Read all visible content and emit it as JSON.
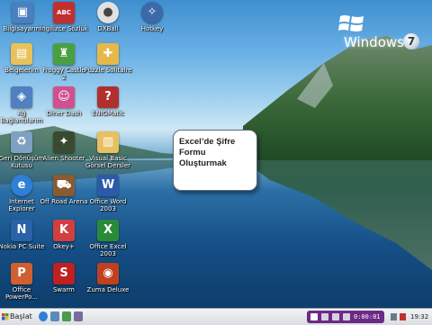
{
  "desktop_icons": [
    {
      "label": "Bilgisayarım",
      "icon": "computer-icon",
      "color": "#4a7fc0"
    },
    {
      "label": "İngilizce Sözlük",
      "icon": "dictionary-icon",
      "color": "#c03030"
    },
    {
      "label": "DXBall",
      "icon": "dxball-icon",
      "color": "#e0e0e0"
    },
    {
      "label": "Hotkey",
      "icon": "hotkey-icon",
      "color": "#3a6aa8"
    },
    {
      "label": "Belgelerim",
      "icon": "documents-folder-icon",
      "color": "#e8c25a"
    },
    {
      "label": "Froggy Castle 2",
      "icon": "frog-game-icon",
      "color": "#4aa040"
    },
    {
      "label": "Puzzle Solitaire",
      "icon": "puzzle-game-icon",
      "color": "#e6b84a"
    },
    {
      "label": "Ağ Bağlantılarım",
      "icon": "network-icon",
      "color": "#5080c0"
    },
    {
      "label": "Diner Dash",
      "icon": "diner-dash-icon",
      "color": "#d05090"
    },
    {
      "label": "ENIGMatic",
      "icon": "enigmatic-icon",
      "color": "#b03030"
    },
    {
      "label": "Geri Dönüşüm Kutusu",
      "icon": "recycle-bin-icon",
      "color": "#7fa0c0"
    },
    {
      "label": "Alien Shooter",
      "icon": "alien-shooter-icon",
      "color": "#3a4a30"
    },
    {
      "label": "Visual Basic Görsel Dersler",
      "icon": "book-folder-icon",
      "color": "#e8c060"
    },
    {
      "label": "Internet Explorer",
      "icon": "internet-explorer-icon",
      "color": "#2f7fd6"
    },
    {
      "label": "Off Road Arena",
      "icon": "off-road-arena-icon",
      "color": "#8a5a30"
    },
    {
      "label": "Office Word 2003",
      "icon": "word-icon",
      "color": "#2b5aa8"
    },
    {
      "label": "Nokia PC Suite",
      "icon": "nokia-pc-suite-icon",
      "color": "#2a62a8"
    },
    {
      "label": "Okey+",
      "icon": "okey-game-icon",
      "color": "#d04040"
    },
    {
      "label": "Office Excel 2003",
      "icon": "excel-icon",
      "color": "#2a8a3a"
    },
    {
      "label": "Office PowerPo...",
      "icon": "powerpoint-icon",
      "color": "#d06030"
    },
    {
      "label": "Swarm",
      "icon": "swarm-game-icon",
      "color": "#c02020"
    },
    {
      "label": "Zuma Deluxe",
      "icon": "zuma-deluxe-icon",
      "color": "#c04020"
    }
  ],
  "windows_logo": {
    "text": "Windows",
    "version": "7"
  },
  "callout": {
    "line1": "Excel’de Şifre",
    "line2": "Formu",
    "line3": "Oluşturmak"
  },
  "taskbar": {
    "start_label": "Başlat",
    "media_time": "0:00:01",
    "clock": "19:32"
  }
}
